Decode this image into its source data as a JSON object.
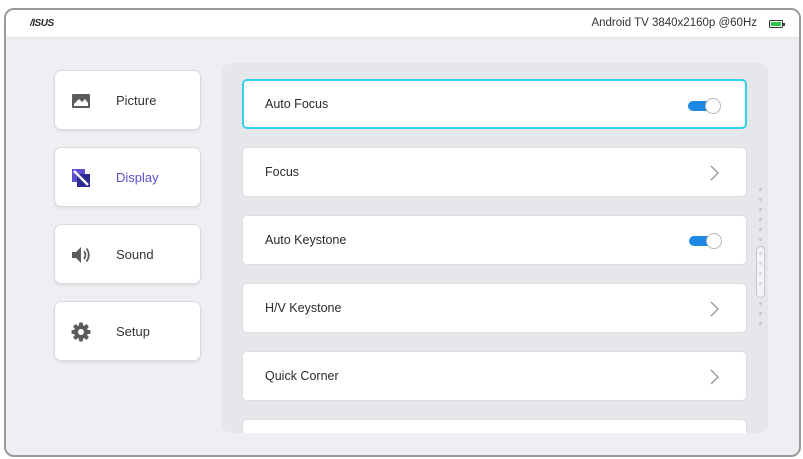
{
  "statusbar": {
    "logo": "/ISUS",
    "status_text": "Android TV  3840x2160p @60Hz",
    "battery_color": "#35c24a"
  },
  "sidebar": {
    "items": [
      {
        "label": "Picture",
        "icon": "picture-icon",
        "active": false
      },
      {
        "label": "Display",
        "icon": "display-icon",
        "active": true
      },
      {
        "label": "Sound",
        "icon": "speaker-icon",
        "active": false
      },
      {
        "label": "Setup",
        "icon": "gear-icon",
        "active": false
      }
    ]
  },
  "menu": {
    "items": [
      {
        "label": "Auto Focus",
        "control": "toggle",
        "state": "on",
        "focused": true
      },
      {
        "label": "Focus",
        "control": "chevron"
      },
      {
        "label": "Auto Keystone",
        "control": "toggle",
        "state": "on"
      },
      {
        "label": "H/V Keystone",
        "control": "chevron"
      },
      {
        "label": "Quick Corner",
        "control": "chevron"
      }
    ]
  },
  "colors": {
    "accent": "#5a4fd3",
    "focus_border": "#2fd2e8",
    "toggle_on": "#1e88e5"
  }
}
